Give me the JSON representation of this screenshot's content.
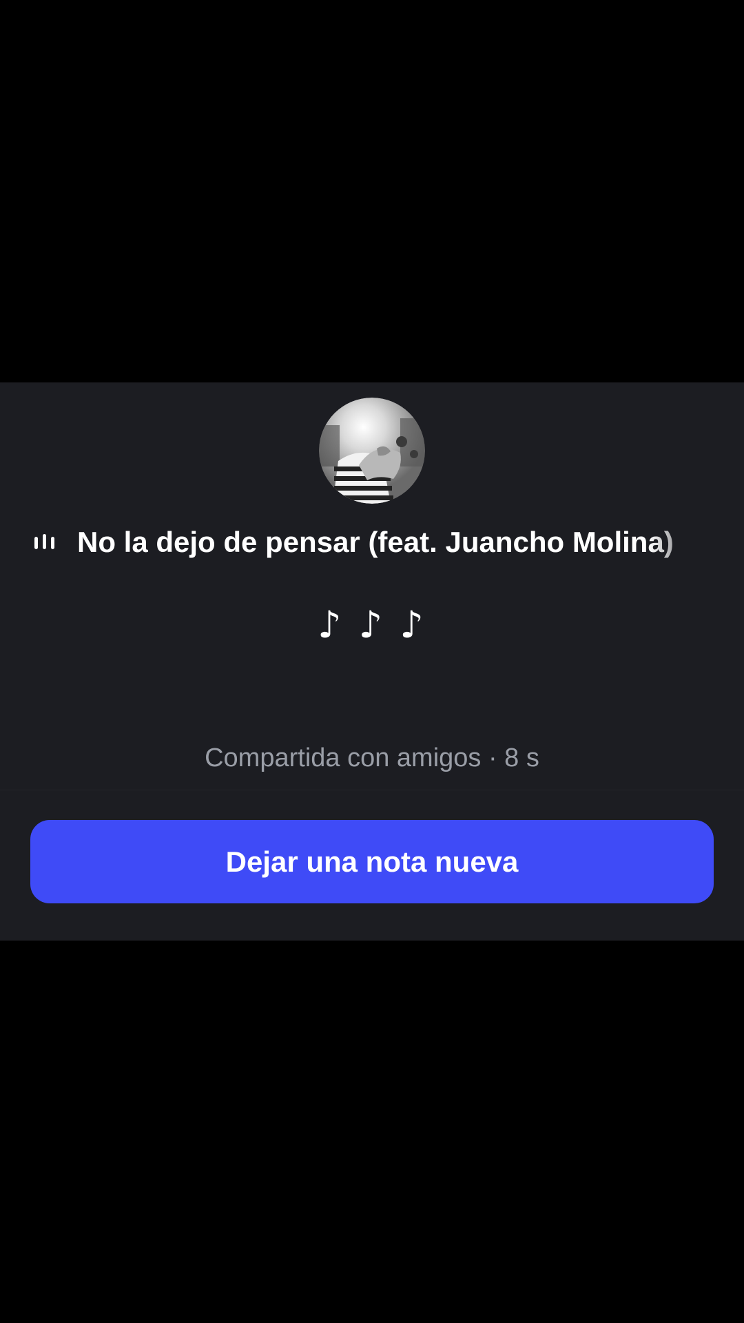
{
  "note": {
    "avatar_icon": "profile-photo",
    "eq_icon": "equalizer-bars-icon",
    "song_title": "No la dejo de pensar (feat. Juancho Molina)",
    "note_text": "♪ ♪ ♪",
    "shared_meta": "Compartida con amigos · 8 s"
  },
  "actions": {
    "new_note_label": "Dejar una nota nueva"
  },
  "colors": {
    "sheet_background": "#1c1d22",
    "button_background": "#3f4bf7",
    "meta_text": "#9a9ea7"
  }
}
